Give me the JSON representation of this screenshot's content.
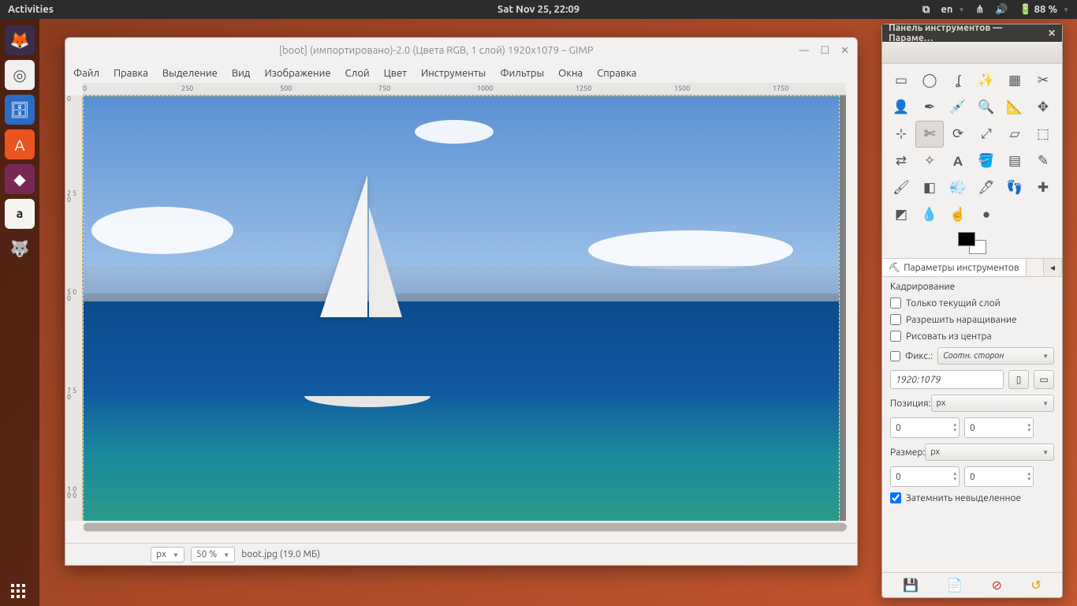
{
  "topbar": {
    "activities": "Activities",
    "datetime": "Sat Nov 25, 22:09",
    "lang": "en",
    "battery": "88 %"
  },
  "launcher": {
    "firefox": "firefox",
    "camera": "camera",
    "files": "files",
    "software": "software-center",
    "purple": "settings",
    "amazon": "a",
    "gimp": "gimp"
  },
  "gimp": {
    "title": "[boot] (импортировано)-2.0 (Цвета RGB, 1 слой) 1920x1079 – GIMP",
    "menu": {
      "file": "Файл",
      "edit": "Правка",
      "select": "Выделение",
      "view": "Вид",
      "image": "Изображение",
      "layer": "Слой",
      "color": "Цвет",
      "tools": "Инструменты",
      "filters": "Фильтры",
      "windows": "Окна",
      "help": "Справка"
    },
    "ruler_h": {
      "r0": "0",
      "r250": "250",
      "r500": "500",
      "r750": "750",
      "r1000": "1000",
      "r1250": "1250",
      "r1500": "1500",
      "r1750": "1750"
    },
    "ruler_v": {
      "r0": "0",
      "r250": "2\n5\n0",
      "r500": "5\n0\n0",
      "r750": "7\n5\n0",
      "r1000": "1\n0\n0\n0"
    },
    "status": {
      "unit": "px",
      "zoom": "50 %",
      "file": "boot.jpg (19.0 МБ)"
    }
  },
  "toolbox": {
    "title": "Панель инструментов — Параме…",
    "tab_options": "Параметры инструментов",
    "options": {
      "heading": "Кадрирование",
      "only_layer": "Только текущий слой",
      "allow_grow": "Разрешить наращивание",
      "from_center": "Рисовать из центра",
      "fixed_label": "Фикс.:",
      "fixed_mode": "Соотн. сторон",
      "ratio": "1920:1079",
      "position_label": "Позиция:",
      "position_unit": "px",
      "pos_x": "0",
      "pos_y": "0",
      "size_label": "Размер:",
      "size_unit": "px",
      "size_w": "0",
      "size_h": "0",
      "darken": "Затемнить невыделенное"
    }
  }
}
